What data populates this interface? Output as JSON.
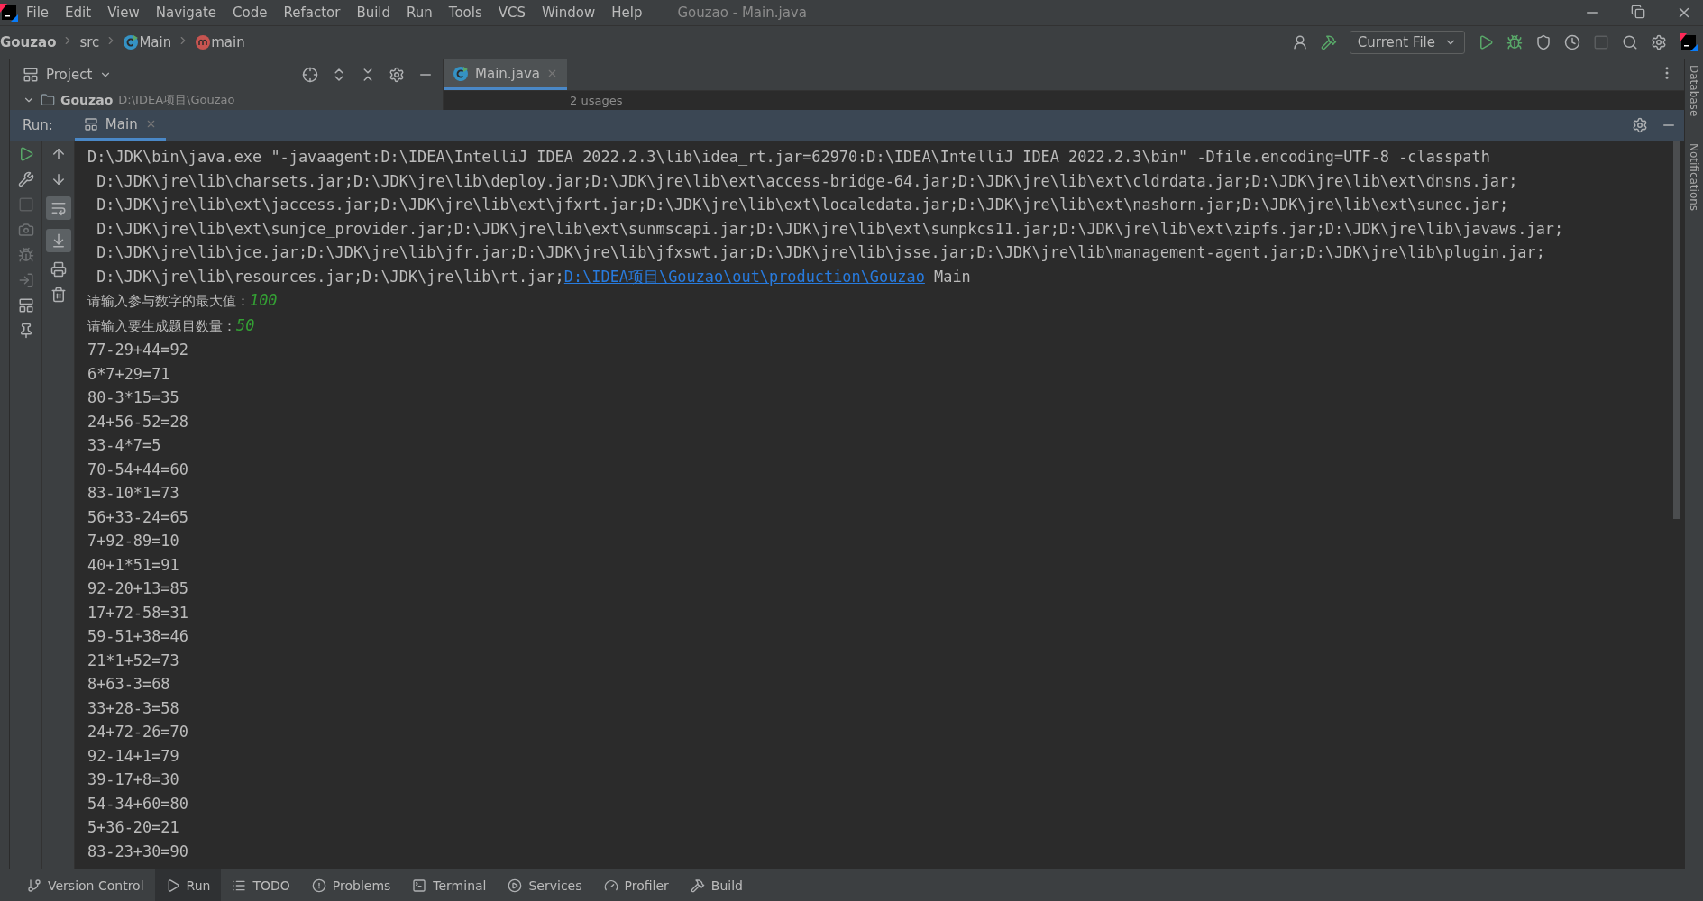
{
  "window": {
    "title": "Gouzao - Main.java"
  },
  "menu": [
    "File",
    "Edit",
    "View",
    "Navigate",
    "Code",
    "Refactor",
    "Build",
    "Run",
    "Tools",
    "VCS",
    "Window",
    "Help"
  ],
  "breadcrumbs": [
    {
      "kind": "project",
      "label": "Gouzao"
    },
    {
      "kind": "folder",
      "label": "src"
    },
    {
      "kind": "class",
      "label": "Main"
    },
    {
      "kind": "method",
      "label": "main"
    }
  ],
  "toolbar": {
    "run_config": "Current File",
    "stop_enabled": false
  },
  "project_panel": {
    "title": "Project",
    "tree_root": {
      "label": "Gouzao",
      "path": "D:\\IDEA项目\\Gouzao",
      "expanded": true
    }
  },
  "editor": {
    "tabs": [
      {
        "label": "Main.java",
        "selected": true
      }
    ],
    "hint": "2 usages"
  },
  "run_panel": {
    "title": "Run:",
    "tabs": [
      {
        "label": "Main",
        "selected": true
      }
    ],
    "toolbar": {
      "soft_wrap_on": true,
      "scroll_to_end_on": true,
      "stop_enabled": false
    },
    "console": [
      {
        "kind": "plain",
        "text": "D:\\JDK\\bin\\java.exe \"-javaagent:D:\\IDEA\\IntelliJ IDEA 2022.2.3\\lib\\idea_rt.jar=62970:D:\\IDEA\\IntelliJ IDEA 2022.2.3\\bin\" -Dfile.encoding=UTF-8 -classpath"
      },
      {
        "kind": "plain",
        "text": " D:\\JDK\\jre\\lib\\charsets.jar;D:\\JDK\\jre\\lib\\deploy.jar;D:\\JDK\\jre\\lib\\ext\\access-bridge-64.jar;D:\\JDK\\jre\\lib\\ext\\cldrdata.jar;D:\\JDK\\jre\\lib\\ext\\dnsns.jar;"
      },
      {
        "kind": "plain",
        "text": " D:\\JDK\\jre\\lib\\ext\\jaccess.jar;D:\\JDK\\jre\\lib\\ext\\jfxrt.jar;D:\\JDK\\jre\\lib\\ext\\localedata.jar;D:\\JDK\\jre\\lib\\ext\\nashorn.jar;D:\\JDK\\jre\\lib\\ext\\sunec.jar;"
      },
      {
        "kind": "plain",
        "text": " D:\\JDK\\jre\\lib\\ext\\sunjce_provider.jar;D:\\JDK\\jre\\lib\\ext\\sunmscapi.jar;D:\\JDK\\jre\\lib\\ext\\sunpkcs11.jar;D:\\JDK\\jre\\lib\\ext\\zipfs.jar;D:\\JDK\\jre\\lib\\javaws.jar;"
      },
      {
        "kind": "plain",
        "text": " D:\\JDK\\jre\\lib\\jce.jar;D:\\JDK\\jre\\lib\\jfr.jar;D:\\JDK\\jre\\lib\\jfxswt.jar;D:\\JDK\\jre\\lib\\jsse.jar;D:\\JDK\\jre\\lib\\management-agent.jar;D:\\JDK\\jre\\lib\\plugin.jar;"
      },
      {
        "kind": "link",
        "text": " D:\\JDK\\jre\\lib\\resources.jar;D:\\JDK\\jre\\lib\\rt.jar;",
        "link": "D:\\IDEA项目\\Gouzao\\out\\production\\Gouzao",
        "after": " Main"
      },
      {
        "kind": "prompt",
        "text": "请输入参与数字的最大值：",
        "input": "100"
      },
      {
        "kind": "prompt",
        "text": "请输入要生成题目数量：",
        "input": "50"
      },
      {
        "kind": "plain",
        "text": "77-29+44=92"
      },
      {
        "kind": "plain",
        "text": "6*7+29=71"
      },
      {
        "kind": "plain",
        "text": "80-3*15=35"
      },
      {
        "kind": "plain",
        "text": "24+56-52=28"
      },
      {
        "kind": "plain",
        "text": "33-4*7=5"
      },
      {
        "kind": "plain",
        "text": "70-54+44=60"
      },
      {
        "kind": "plain",
        "text": "83-10*1=73"
      },
      {
        "kind": "plain",
        "text": "56+33-24=65"
      },
      {
        "kind": "plain",
        "text": "7+92-89=10"
      },
      {
        "kind": "plain",
        "text": "40+1*51=91"
      },
      {
        "kind": "plain",
        "text": "92-20+13=85"
      },
      {
        "kind": "plain",
        "text": "17+72-58=31"
      },
      {
        "kind": "plain",
        "text": "59-51+38=46"
      },
      {
        "kind": "plain",
        "text": "21*1+52=73"
      },
      {
        "kind": "plain",
        "text": "8+63-3=68"
      },
      {
        "kind": "plain",
        "text": "33+28-3=58"
      },
      {
        "kind": "plain",
        "text": "24+72-26=70"
      },
      {
        "kind": "plain",
        "text": "92-14+1=79"
      },
      {
        "kind": "plain",
        "text": "39-17+8=30"
      },
      {
        "kind": "plain",
        "text": "54-34+60=80"
      },
      {
        "kind": "plain",
        "text": "5+36-20=21"
      },
      {
        "kind": "plain",
        "text": "83-23+30=90"
      }
    ]
  },
  "right_strip": [
    "Database",
    "Notifications"
  ],
  "tool_windows": [
    {
      "kind": "vcs",
      "label": "Version Control",
      "selected": false
    },
    {
      "kind": "run",
      "label": "Run",
      "selected": true
    },
    {
      "kind": "todo",
      "label": "TODO",
      "selected": false
    },
    {
      "kind": "problems",
      "label": "Problems",
      "selected": false
    },
    {
      "kind": "terminal",
      "label": "Terminal",
      "selected": false
    },
    {
      "kind": "services",
      "label": "Services",
      "selected": false
    },
    {
      "kind": "profiler",
      "label": "Profiler",
      "selected": false
    },
    {
      "kind": "build",
      "label": "Build",
      "selected": false
    }
  ]
}
